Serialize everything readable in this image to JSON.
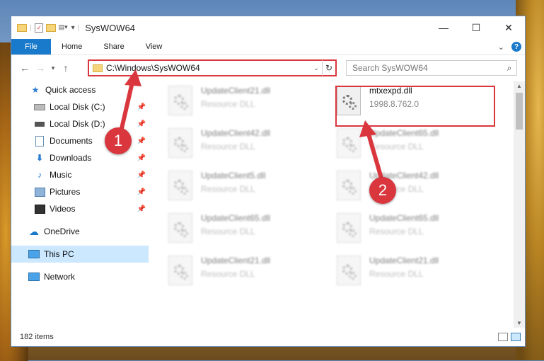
{
  "window": {
    "title": "SysWOW64",
    "ribbon_tabs": [
      "File",
      "Home",
      "Share",
      "View"
    ],
    "minimize": "—",
    "maximize": "☐",
    "close": "✕",
    "help": "?"
  },
  "nav": {
    "address": "C:\\Windows\\SysWOW64",
    "search_placeholder": "Search SysWOW64"
  },
  "sidebar": {
    "items": [
      {
        "label": "Quick access",
        "icon": "star-icon",
        "pinned": false
      },
      {
        "label": "Local Disk (C:)",
        "icon": "drive-icon",
        "pinned": true
      },
      {
        "label": "Local Disk (D:)",
        "icon": "drive-icon",
        "pinned": true
      },
      {
        "label": "Documents",
        "icon": "documents-icon",
        "pinned": true
      },
      {
        "label": "Downloads",
        "icon": "download-arrow-icon",
        "pinned": true
      },
      {
        "label": "Music",
        "icon": "music-note-icon",
        "pinned": true
      },
      {
        "label": "Pictures",
        "icon": "pictures-icon",
        "pinned": true
      },
      {
        "label": "Videos",
        "icon": "videos-icon",
        "pinned": true
      },
      {
        "label": "OneDrive",
        "icon": "cloud-icon",
        "pinned": false
      },
      {
        "label": "This PC",
        "icon": "monitor-icon",
        "pinned": false,
        "selected": true
      },
      {
        "label": "Network",
        "icon": "network-icon",
        "pinned": false
      }
    ]
  },
  "files": [
    {
      "name": "UpdateClient21.dll",
      "type": "Resource DLL"
    },
    {
      "name": "mtxexpd.dll",
      "type": "1998.8.762.0"
    },
    {
      "name": "UpdateClient42.dll",
      "type": "Resource DLL"
    },
    {
      "name": "UpdateClient65.dll",
      "type": "Resource DLL"
    },
    {
      "name": "UpdateClient5.dll",
      "type": "Resource DLL"
    },
    {
      "name": "UpdateClient42.dll",
      "type": "Resource DLL"
    },
    {
      "name": "UpdateClient65.dll",
      "type": "Resource DLL"
    },
    {
      "name": "UpdateClient65.dll",
      "type": "Resource DLL"
    },
    {
      "name": "UpdateClient21.dll",
      "type": "Resource DLL"
    },
    {
      "name": "UpdateClient21.dll",
      "type": "Resource DLL"
    }
  ],
  "status": {
    "item_count": "182 items"
  },
  "annotations": {
    "step1": "1",
    "step2": "2"
  },
  "colors": {
    "accent": "#1979ca",
    "highlight_red": "#d9363e",
    "selection": "#cce8ff"
  }
}
